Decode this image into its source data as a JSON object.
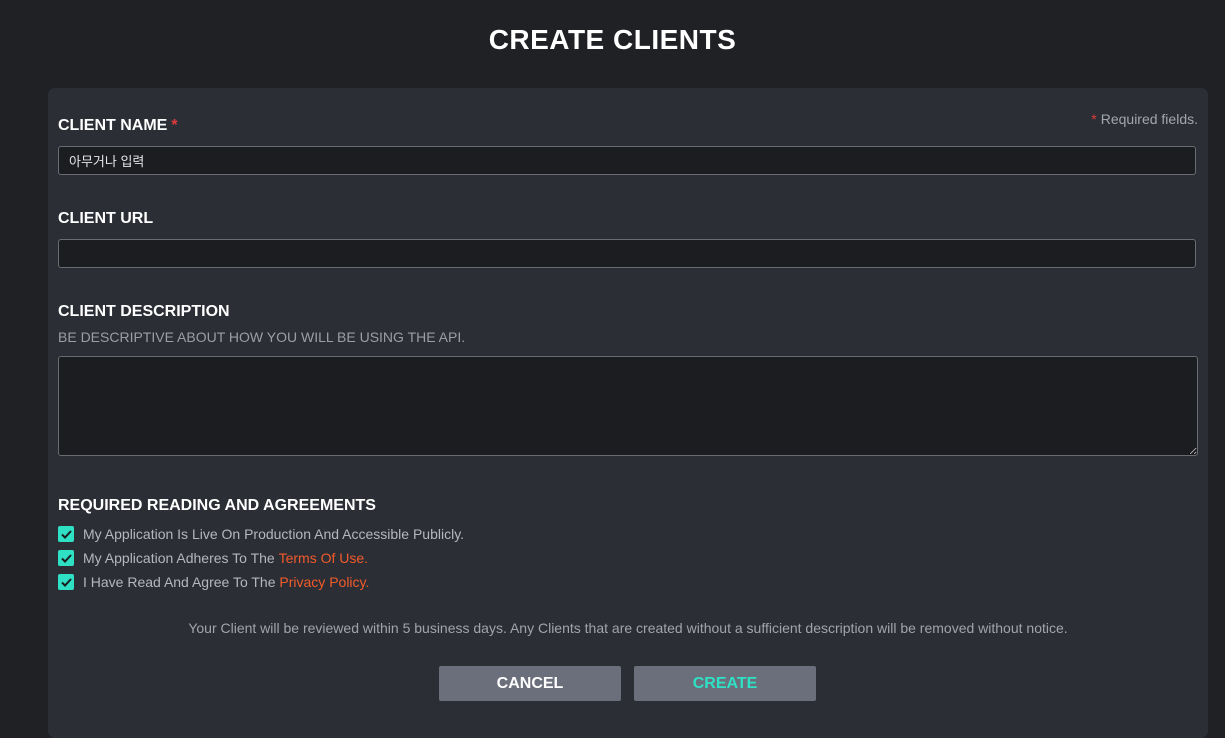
{
  "page": {
    "title": "CREATE CLIENTS"
  },
  "form": {
    "required_star": "*",
    "required_note": "Required fields.",
    "client_name": {
      "label": "CLIENT NAME",
      "value": "아무거나 입력"
    },
    "client_url": {
      "label": "CLIENT URL",
      "value": ""
    },
    "client_description": {
      "label": "CLIENT DESCRIPTION",
      "hint": "BE DESCRIPTIVE ABOUT HOW YOU WILL BE USING THE API.",
      "value": ""
    },
    "agreements": {
      "heading": "REQUIRED READING AND AGREEMENTS",
      "items": [
        {
          "text": "My Application Is Live On Production And Accessible Publicly.",
          "link": "",
          "checked": true
        },
        {
          "text": "My Application Adheres To The ",
          "link": "Terms Of Use.",
          "checked": true
        },
        {
          "text": "I Have Read And Agree To The ",
          "link": "Privacy Policy.",
          "checked": true
        }
      ]
    },
    "review_note": "Your Client will be reviewed within 5 business days. Any Clients that are created without a sufficient description will be removed without notice.",
    "buttons": {
      "cancel": "CANCEL",
      "create": "CREATE"
    }
  },
  "colors": {
    "background": "#202125",
    "panel": "#2c2e36",
    "accent": "#2ee0c4",
    "link": "#f25b2a",
    "required": "#e23b3b"
  }
}
